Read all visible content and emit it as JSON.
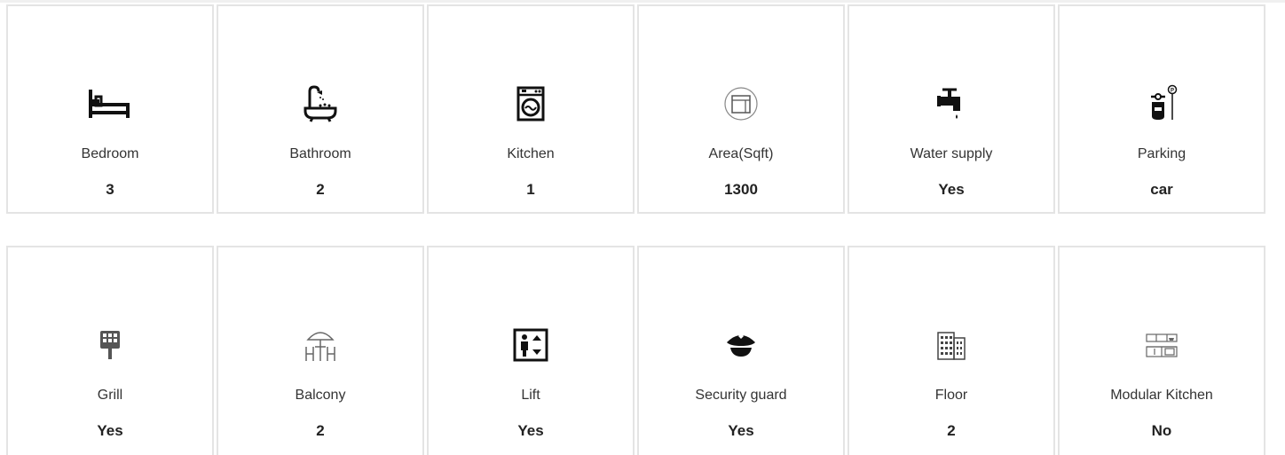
{
  "features": [
    {
      "label": "Bedroom",
      "value": "3",
      "icon": "bed-icon"
    },
    {
      "label": "Bathroom",
      "value": "2",
      "icon": "bathtub-icon"
    },
    {
      "label": "Kitchen",
      "value": "1",
      "icon": "kitchen-appliance-icon"
    },
    {
      "label": "Area(Sqft)",
      "value": "1300",
      "icon": "area-icon"
    },
    {
      "label": "Water supply",
      "value": "Yes",
      "icon": "tap-icon"
    },
    {
      "label": "Parking",
      "value": "car",
      "icon": "parking-icon"
    },
    {
      "label": "Grill",
      "value": "Yes",
      "icon": "grill-icon"
    },
    {
      "label": "Balcony",
      "value": "2",
      "icon": "balcony-icon"
    },
    {
      "label": "Lift",
      "value": "Yes",
      "icon": "lift-icon"
    },
    {
      "label": "Security guard",
      "value": "Yes",
      "icon": "security-guard-icon"
    },
    {
      "label": "Floor",
      "value": "2",
      "icon": "building-icon"
    },
    {
      "label": "Modular Kitchen",
      "value": "No",
      "icon": "modular-kitchen-icon"
    }
  ]
}
